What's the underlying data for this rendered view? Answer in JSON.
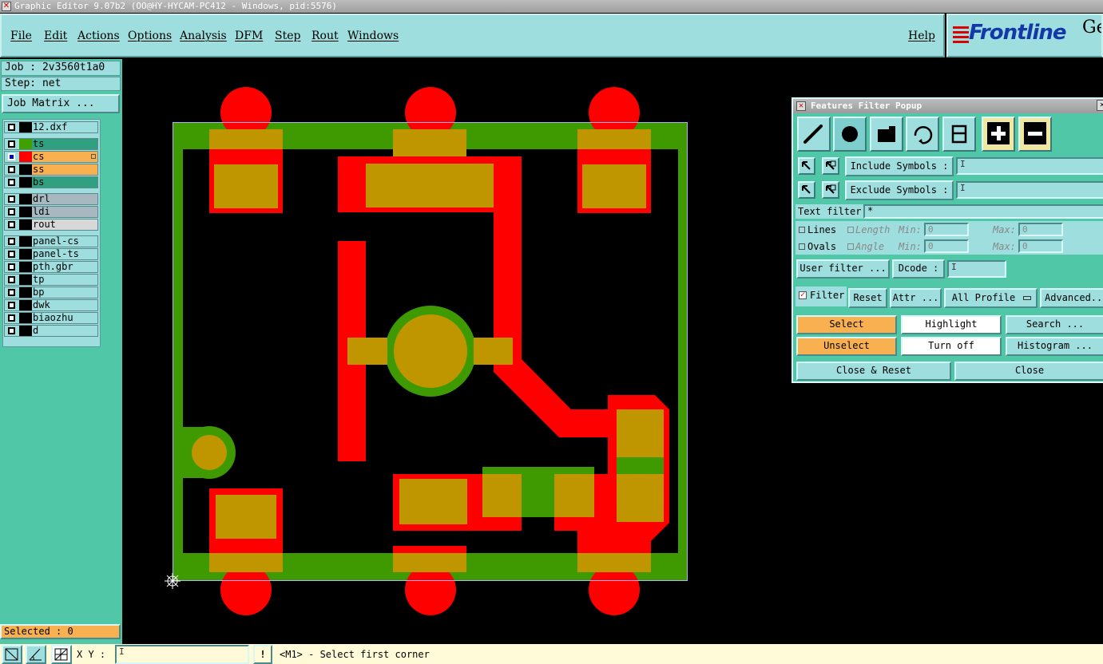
{
  "window": {
    "title": "Graphic Editor 9.07b2 (OO@HY-HYCAM-PC412 - Windows, pid:5576)"
  },
  "menu": {
    "items": [
      "File",
      "Edit",
      "Actions",
      "Options",
      "Analysis",
      "DFM",
      "Step",
      "Rout",
      "Windows"
    ],
    "help": "Help"
  },
  "logo": {
    "brand": "Frontline",
    "suffix": "Ge"
  },
  "job": {
    "job_label": "Job : 2v3560t1a0",
    "step_label": "Step: net",
    "matrix_button": "Job Matrix ..."
  },
  "layers": [
    {
      "name": "12.dxf",
      "swatch": "#000000",
      "bg": "#9edede",
      "active": false
    },
    {
      "name": "ts",
      "swatch": "#40a000",
      "bg": "#30a080",
      "active": false
    },
    {
      "name": "cs",
      "swatch": "#ff0000",
      "bg": "#f8b050",
      "active": true
    },
    {
      "name": "ss",
      "swatch": "#000000",
      "bg": "#f8b050",
      "active": false
    },
    {
      "name": "bs",
      "swatch": "#000000",
      "bg": "#30a080",
      "active": false
    },
    {
      "name": "drl",
      "swatch": "#000000",
      "bg": "#a8b8c0",
      "active": false
    },
    {
      "name": "ldi",
      "swatch": "#000000",
      "bg": "#a8b8c0",
      "active": false
    },
    {
      "name": "rout",
      "swatch": "#000000",
      "bg": "#d8d8d8",
      "active": false
    },
    {
      "name": "panel-cs",
      "swatch": "#000000",
      "bg": "#9edede",
      "active": false
    },
    {
      "name": "panel-ts",
      "swatch": "#000000",
      "bg": "#9edede",
      "active": false
    },
    {
      "name": "pth.gbr",
      "swatch": "#000000",
      "bg": "#9edede",
      "active": false
    },
    {
      "name": "tp",
      "swatch": "#000000",
      "bg": "#9edede",
      "active": false
    },
    {
      "name": "bp",
      "swatch": "#000000",
      "bg": "#9edede",
      "active": false
    },
    {
      "name": "dwk",
      "swatch": "#000000",
      "bg": "#9edede",
      "active": false
    },
    {
      "name": "biaozhu",
      "swatch": "#000000",
      "bg": "#9edede",
      "active": false
    },
    {
      "name": "d",
      "swatch": "#000000",
      "bg": "#9edede",
      "active": false
    }
  ],
  "status": {
    "selected": "Selected : 0",
    "xy_label": "X Y :",
    "message": "<M1> - Select first corner"
  },
  "filter_popup": {
    "title": "Features Filter Popup",
    "include_symbols": "Include Symbols :",
    "exclude_symbols": "Exclude Symbols :",
    "text_filter": "Text filter",
    "text_filter_value": "*",
    "lines": "Lines",
    "ovals": "Ovals",
    "length": "Length",
    "angle": "Angle",
    "min": "Min:",
    "max": "Max:",
    "zero": "0",
    "user_filter": "User filter ...",
    "dcode": "Dcode :",
    "filter": "Filter",
    "reset": "Reset",
    "attr": "Attr ...",
    "all_profile": "All Profile",
    "advanced": "Advanced...",
    "select": "Select",
    "highlight": "Highlight",
    "search": "Search ...",
    "unselect": "Unselect",
    "turn_off": "Turn off",
    "histogram": "Histogram ...",
    "close_reset": "Close & Reset",
    "close": "Close"
  },
  "colors": {
    "copper": "#ff0000",
    "mask": "#3e9a00",
    "overlap": "#c09600",
    "panel": "#9edede",
    "accent": "#50c8a8"
  }
}
